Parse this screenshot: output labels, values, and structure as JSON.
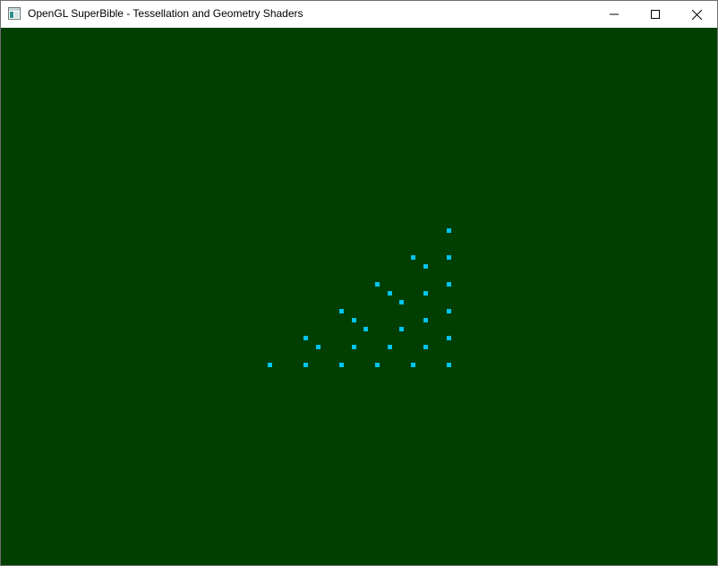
{
  "window": {
    "title": "OpenGL SuperBible - Tessellation and Geometry Shaders",
    "icon": "app-window-icon",
    "controls": {
      "minimize_icon": "minimize-icon",
      "maximize_icon": "maximize-icon",
      "close_icon": "close-icon"
    }
  },
  "scene": {
    "background_color": "#003f00",
    "point_color": "#00c4ee"
  }
}
